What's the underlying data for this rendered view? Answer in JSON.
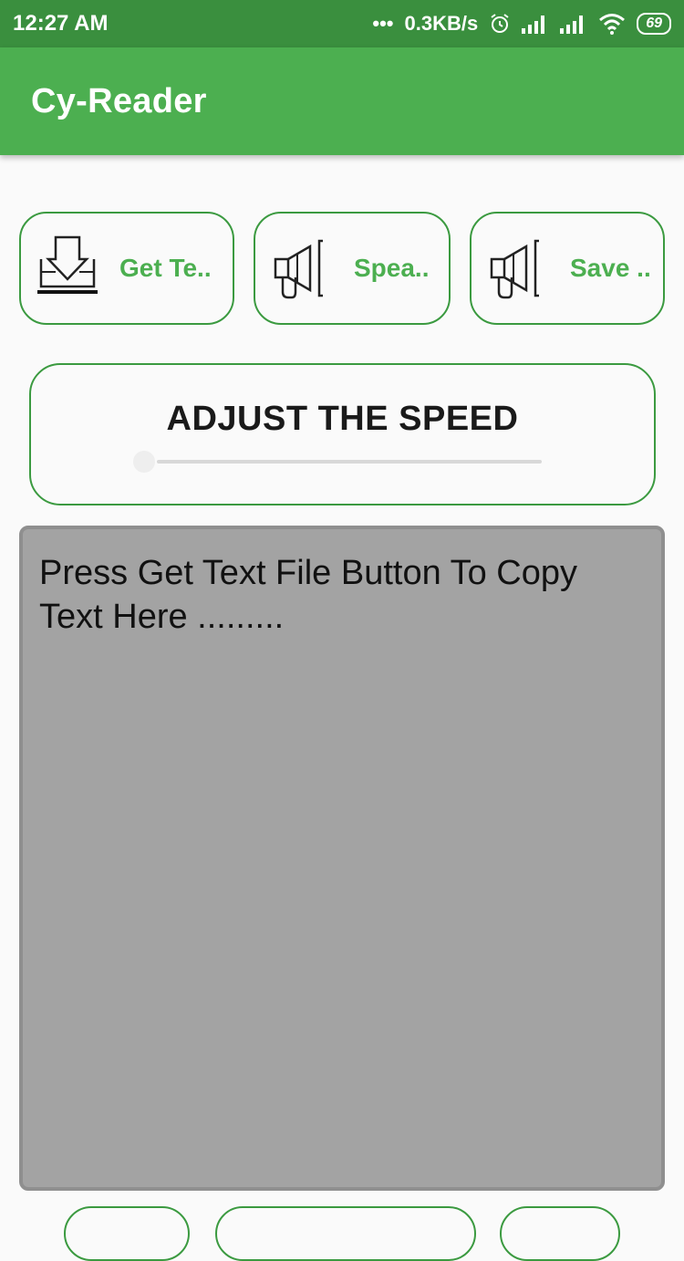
{
  "status_bar": {
    "time": "12:27 AM",
    "dots": "•••",
    "net_speed": "0.3KB/s",
    "battery": "69"
  },
  "app": {
    "title": "Cy-Reader"
  },
  "actions": {
    "get_text_label": "Get Te..",
    "speak_label": "Spea..",
    "save_label": "Save .."
  },
  "speed": {
    "title": "ADJUST THE SPEED",
    "slider_value": 0
  },
  "text_area": {
    "content": "Press Get Text File Button To Copy Text Here ........."
  },
  "colors": {
    "primary": "#4caf50",
    "primary_dark": "#3a8f3e",
    "outline": "#3b9a40",
    "text_area_bg": "#a3a3a3"
  },
  "icons": {
    "status": [
      "alarm-icon",
      "signal-icon",
      "signal-icon",
      "wifi-icon",
      "battery-icon"
    ],
    "get_text": "download-tray-icon",
    "speak": "megaphone-icon",
    "save": "megaphone-icon"
  }
}
